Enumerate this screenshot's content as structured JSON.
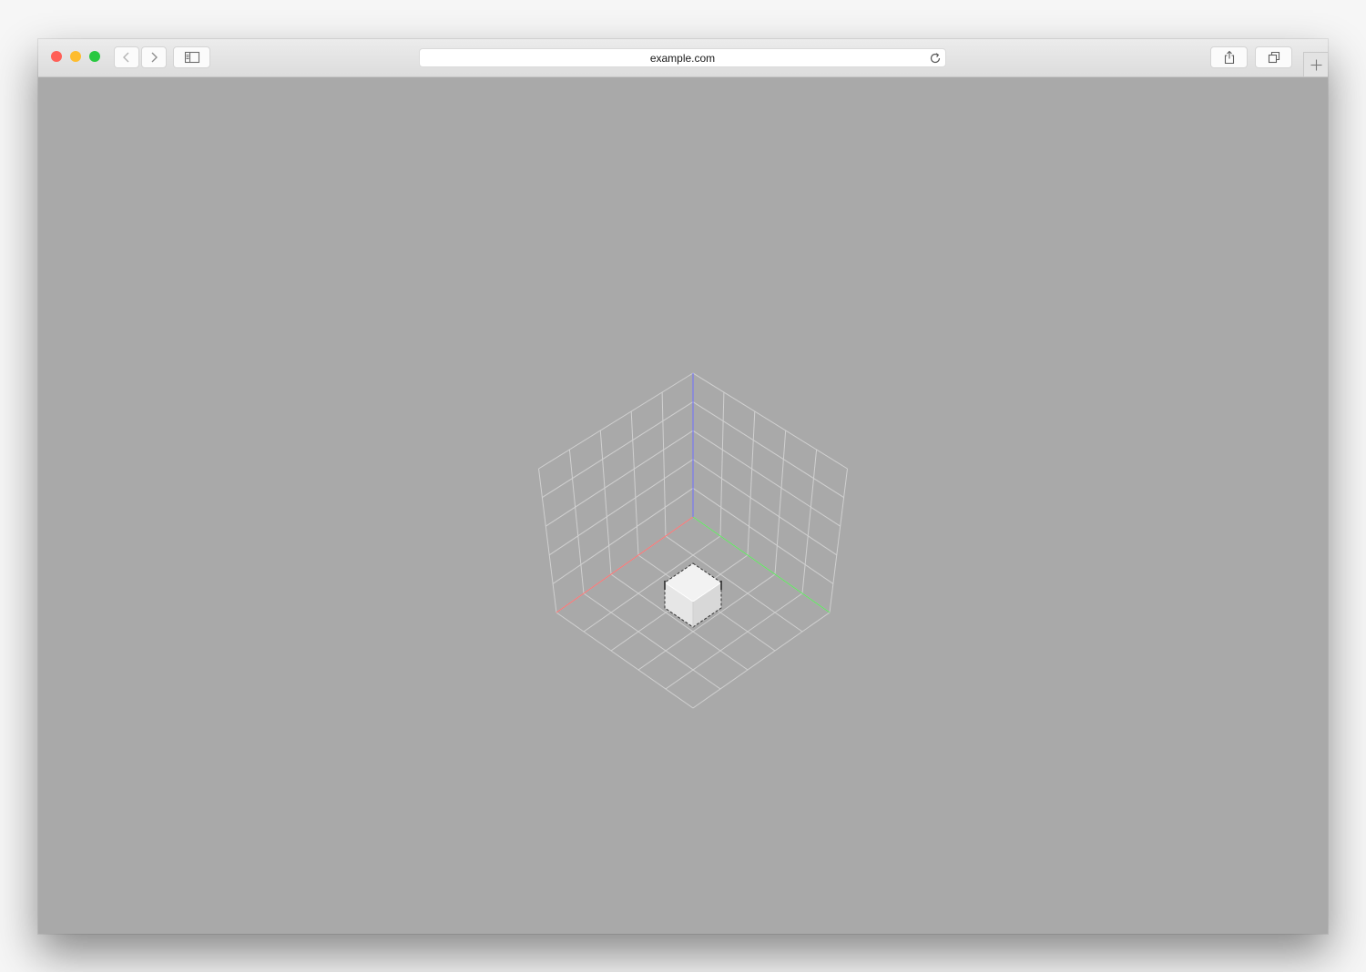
{
  "browser": {
    "url": "example.com",
    "controls": {
      "close_color": "#ff5f57",
      "minimize_color": "#febc2e",
      "zoom_color": "#28c840"
    },
    "icons": {
      "back": "chevron-left-icon",
      "forward": "chevron-right-icon",
      "sidebar": "sidebar-icon",
      "reload": "reload-icon",
      "share": "share-icon",
      "tabs": "tabs-overview-icon",
      "new_tab": "plus-icon"
    }
  },
  "scene": {
    "background_color": "#a9a9a9",
    "grid_color": "#d0d0d0",
    "axis_colors": {
      "x": "#ff7070",
      "y": "#5ce65c",
      "z": "#7070ff"
    },
    "grid_divisions": 5,
    "cube": {
      "selected": true,
      "face_colors": [
        "#f2f2f2",
        "#e6e6e6",
        "#d8d8d8"
      ]
    }
  }
}
